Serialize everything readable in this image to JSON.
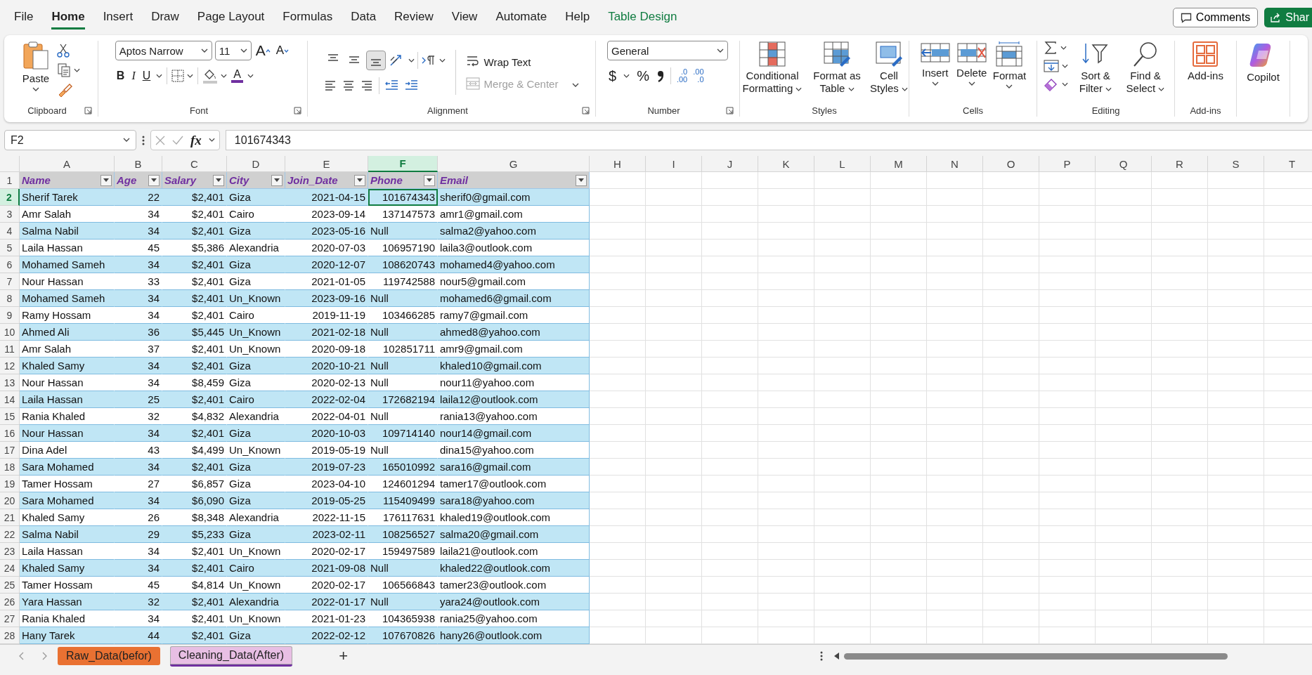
{
  "menu_tabs": [
    {
      "label": "File",
      "selected": false,
      "kind": "standard"
    },
    {
      "label": "Home",
      "selected": true,
      "kind": "standard"
    },
    {
      "label": "Insert",
      "selected": false,
      "kind": "standard"
    },
    {
      "label": "Draw",
      "selected": false,
      "kind": "standard"
    },
    {
      "label": "Page Layout",
      "selected": false,
      "kind": "standard"
    },
    {
      "label": "Formulas",
      "selected": false,
      "kind": "standard"
    },
    {
      "label": "Data",
      "selected": false,
      "kind": "standard"
    },
    {
      "label": "Review",
      "selected": false,
      "kind": "standard"
    },
    {
      "label": "View",
      "selected": false,
      "kind": "standard"
    },
    {
      "label": "Automate",
      "selected": false,
      "kind": "standard"
    },
    {
      "label": "Help",
      "selected": false,
      "kind": "standard"
    },
    {
      "label": "Table Design",
      "selected": false,
      "kind": "contextual"
    }
  ],
  "header_buttons": {
    "comments": "Comments",
    "share": "Shar"
  },
  "ribbon": [
    {
      "kind": "clipboard",
      "label": "Clipboard",
      "paste": "Paste"
    },
    {
      "kind": "font",
      "label": "Font",
      "font_name": "Aptos Narrow",
      "font_size": "11",
      "grow": "A",
      "shrink": "A",
      "bold": "B",
      "italic": "I",
      "underline": "U",
      "font_color": "A"
    },
    {
      "kind": "alignment",
      "label": "Alignment",
      "vertical_align": [
        {
          "selected": false
        },
        {
          "selected": false
        },
        {
          "selected": true
        }
      ],
      "wrap_text": "Wrap Text",
      "merge_center": {
        "label": "Merge & Center",
        "disabled": true
      }
    },
    {
      "kind": "number",
      "label": "Number",
      "format": "General",
      "currency": "$",
      "percent": "%",
      "increase_decimal": [
        ".0",
        ".00"
      ],
      "decrease_decimal": [
        ".00",
        ".0"
      ]
    },
    {
      "kind": "styles",
      "label": "Styles",
      "buttons": [
        "Conditional Formatting",
        "Format as Table",
        "Cell Styles"
      ]
    },
    {
      "kind": "cells",
      "label": "Cells",
      "buttons": [
        "Insert",
        "Delete",
        "Format"
      ]
    },
    {
      "kind": "editing",
      "label": "Editing",
      "buttons": [
        "Sort & Filter",
        "Find & Select"
      ]
    },
    {
      "kind": "addins",
      "label": "Add-ins",
      "buttons": [
        "Add-ins"
      ]
    },
    {
      "kind": "copilot",
      "buttons": [
        "Copilot"
      ]
    }
  ],
  "formula_bar": {
    "name_box": "F2",
    "fx": "fx",
    "value": "101674343"
  },
  "sheet": {
    "columns": [
      {
        "label": "A",
        "selected": false
      },
      {
        "label": "B",
        "selected": false
      },
      {
        "label": "C",
        "selected": false
      },
      {
        "label": "D",
        "selected": false
      },
      {
        "label": "E",
        "selected": false
      },
      {
        "label": "F",
        "selected": true
      },
      {
        "label": "G",
        "selected": false
      },
      {
        "label": "H",
        "selected": false
      },
      {
        "label": "I",
        "selected": false
      },
      {
        "label": "J",
        "selected": false
      },
      {
        "label": "K",
        "selected": false
      },
      {
        "label": "L",
        "selected": false
      },
      {
        "label": "M",
        "selected": false
      },
      {
        "label": "N",
        "selected": false
      },
      {
        "label": "O",
        "selected": false
      },
      {
        "label": "P",
        "selected": false
      },
      {
        "label": "Q",
        "selected": false
      },
      {
        "label": "R",
        "selected": false
      },
      {
        "label": "S",
        "selected": false
      },
      {
        "label": "T",
        "selected": false
      }
    ],
    "header_row_number": "1",
    "banded_rows": true,
    "headers": [
      "Name",
      "Age",
      "Salary",
      "City",
      "Join_Date",
      "Phone",
      "Email"
    ],
    "rows": [
      {
        "number": "2",
        "selected": true,
        "cells": [
          "Sherif Tarek",
          "22",
          "$2,401",
          "Giza",
          "2021-04-15",
          "101674343",
          "sherif0@gmail.com"
        ]
      },
      {
        "number": "3",
        "selected": false,
        "cells": [
          "Amr Salah",
          "34",
          "$2,401",
          "Cairo",
          "2023-09-14",
          "137147573",
          "amr1@gmail.com"
        ]
      },
      {
        "number": "4",
        "selected": false,
        "cells": [
          "Salma Nabil",
          "34",
          "$2,401",
          "Giza",
          "2023-05-16",
          "Null",
          "salma2@yahoo.com"
        ]
      },
      {
        "number": "5",
        "selected": false,
        "cells": [
          "Laila Hassan",
          "45",
          "$5,386",
          "Alexandria",
          "2020-07-03",
          "106957190",
          "laila3@outlook.com"
        ]
      },
      {
        "number": "6",
        "selected": false,
        "cells": [
          "Mohamed Sameh",
          "34",
          "$2,401",
          "Giza",
          "2020-12-07",
          "108620743",
          "mohamed4@yahoo.com"
        ]
      },
      {
        "number": "7",
        "selected": false,
        "cells": [
          "Nour Hassan",
          "33",
          "$2,401",
          "Giza",
          "2021-01-05",
          "119742588",
          "nour5@gmail.com"
        ]
      },
      {
        "number": "8",
        "selected": false,
        "cells": [
          "Mohamed Sameh",
          "34",
          "$2,401",
          "Un_Known",
          "2023-09-16",
          "Null",
          "mohamed6@gmail.com"
        ]
      },
      {
        "number": "9",
        "selected": false,
        "cells": [
          "Ramy Hossam",
          "34",
          "$2,401",
          "Cairo",
          "2019-11-19",
          "103466285",
          "ramy7@gmail.com"
        ]
      },
      {
        "number": "10",
        "selected": false,
        "cells": [
          "Ahmed Ali",
          "36",
          "$5,445",
          "Un_Known",
          "2021-02-18",
          "Null",
          "ahmed8@yahoo.com"
        ]
      },
      {
        "number": "11",
        "selected": false,
        "cells": [
          "Amr Salah",
          "37",
          "$2,401",
          "Un_Known",
          "2020-09-18",
          "102851711",
          "amr9@gmail.com"
        ]
      },
      {
        "number": "12",
        "selected": false,
        "cells": [
          "Khaled Samy",
          "34",
          "$2,401",
          "Giza",
          "2020-10-21",
          "Null",
          "khaled10@gmail.com"
        ]
      },
      {
        "number": "13",
        "selected": false,
        "cells": [
          "Nour Hassan",
          "34",
          "$8,459",
          "Giza",
          "2020-02-13",
          "Null",
          "nour11@yahoo.com"
        ]
      },
      {
        "number": "14",
        "selected": false,
        "cells": [
          "Laila Hassan",
          "25",
          "$2,401",
          "Cairo",
          "2022-02-04",
          "172682194",
          "laila12@outlook.com"
        ]
      },
      {
        "number": "15",
        "selected": false,
        "cells": [
          "Rania Khaled",
          "32",
          "$4,832",
          "Alexandria",
          "2022-04-01",
          "Null",
          "rania13@yahoo.com"
        ]
      },
      {
        "number": "16",
        "selected": false,
        "cells": [
          "Nour Hassan",
          "34",
          "$2,401",
          "Giza",
          "2020-10-03",
          "109714140",
          "nour14@gmail.com"
        ]
      },
      {
        "number": "17",
        "selected": false,
        "cells": [
          "Dina Adel",
          "43",
          "$4,499",
          "Un_Known",
          "2019-05-19",
          "Null",
          "dina15@yahoo.com"
        ]
      },
      {
        "number": "18",
        "selected": false,
        "cells": [
          "Sara Mohamed",
          "34",
          "$2,401",
          "Giza",
          "2019-07-23",
          "165010992",
          "sara16@gmail.com"
        ]
      },
      {
        "number": "19",
        "selected": false,
        "cells": [
          "Tamer Hossam",
          "27",
          "$6,857",
          "Giza",
          "2023-04-10",
          "124601294",
          "tamer17@outlook.com"
        ]
      },
      {
        "number": "20",
        "selected": false,
        "cells": [
          "Sara Mohamed",
          "34",
          "$6,090",
          "Giza",
          "2019-05-25",
          "115409499",
          "sara18@yahoo.com"
        ]
      },
      {
        "number": "21",
        "selected": false,
        "cells": [
          "Khaled Samy",
          "26",
          "$8,348",
          "Alexandria",
          "2022-11-15",
          "176117631",
          "khaled19@outlook.com"
        ]
      },
      {
        "number": "22",
        "selected": false,
        "cells": [
          "Salma Nabil",
          "29",
          "$5,233",
          "Giza",
          "2023-02-11",
          "108256527",
          "salma20@gmail.com"
        ]
      },
      {
        "number": "23",
        "selected": false,
        "cells": [
          "Laila Hassan",
          "34",
          "$2,401",
          "Un_Known",
          "2020-02-17",
          "159497589",
          "laila21@outlook.com"
        ]
      },
      {
        "number": "24",
        "selected": false,
        "cells": [
          "Khaled Samy",
          "34",
          "$2,401",
          "Cairo",
          "2021-09-08",
          "Null",
          "khaled22@outlook.com"
        ]
      },
      {
        "number": "25",
        "selected": false,
        "cells": [
          "Tamer Hossam",
          "45",
          "$4,814",
          "Un_Known",
          "2020-02-17",
          "106566843",
          "tamer23@outlook.com"
        ]
      },
      {
        "number": "26",
        "selected": false,
        "cells": [
          "Yara Hassan",
          "32",
          "$2,401",
          "Alexandria",
          "2022-01-17",
          "Null",
          "yara24@outlook.com"
        ]
      },
      {
        "number": "27",
        "selected": false,
        "cells": [
          "Rania Khaled",
          "34",
          "$2,401",
          "Un_Known",
          "2021-01-23",
          "104365938",
          "rania25@yahoo.com"
        ]
      },
      {
        "number": "28",
        "selected": false,
        "cells": [
          "Hany Tarek",
          "44",
          "$2,401",
          "Giza",
          "2022-02-12",
          "107670826",
          "hany26@outlook.com"
        ]
      }
    ]
  },
  "sheet_tabs": [
    {
      "label": "Raw_Data(befor)",
      "color": "#e97132",
      "selected": false
    },
    {
      "label": "Cleaning_Data(After)",
      "color": "#e8bfe4",
      "selected": true
    }
  ],
  "add_sheet": "+"
}
